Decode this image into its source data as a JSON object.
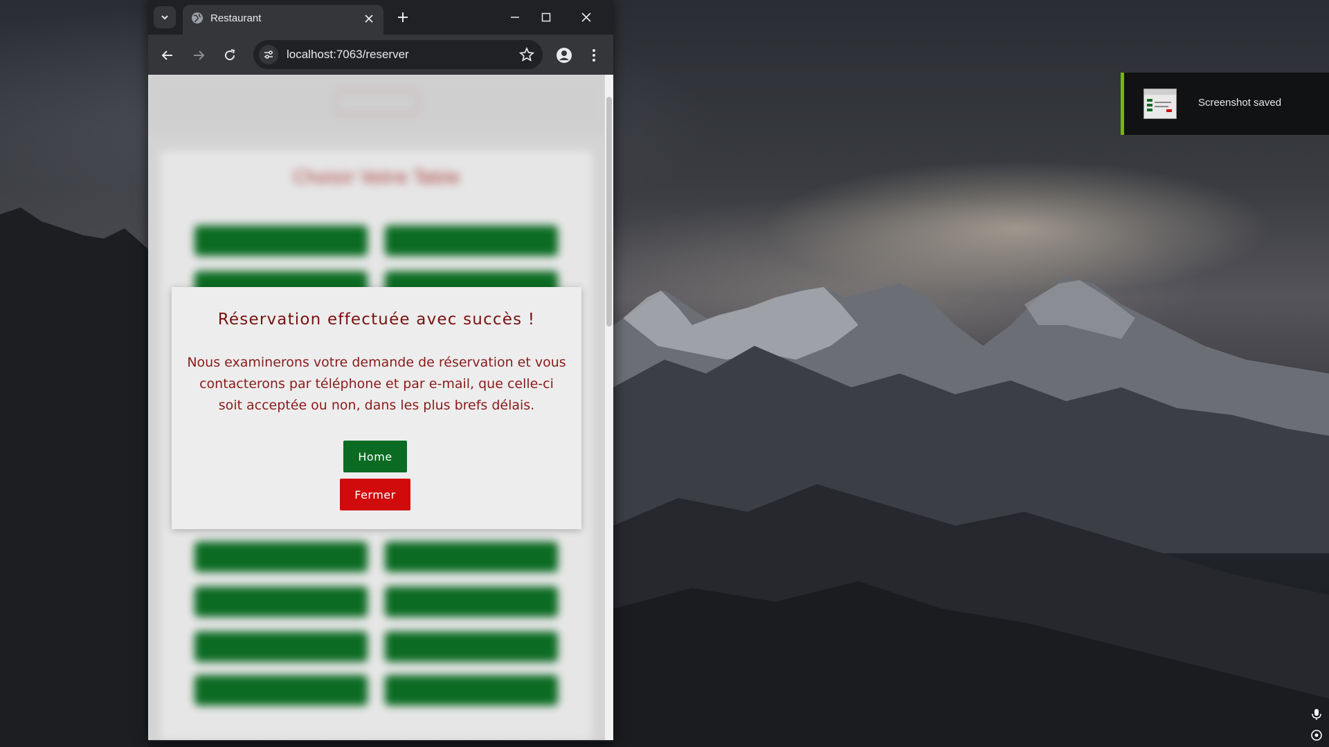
{
  "browser": {
    "tab_title": "Restaurant",
    "url": "localhost:7063/reserver",
    "tab_list_icon": "chevron-down-icon",
    "tab_favicon": "globe-icon"
  },
  "page": {
    "background_heading": "Choisir Votre Table",
    "modal": {
      "title": "Réservation effectuée avec succès !",
      "body": "Nous examinerons votre demande de réservation et vous contacterons par téléphone et par e-mail, que celle-ci soit acceptée ou non, dans les plus brefs délais.",
      "home_label": "Home",
      "close_label": "Fermer"
    }
  },
  "toast": {
    "message": "Screenshot saved",
    "accent_color": "#76b900"
  },
  "colors": {
    "primary_green": "#0b6b22",
    "danger_red": "#d10b0b",
    "title_red": "#7a1010"
  }
}
